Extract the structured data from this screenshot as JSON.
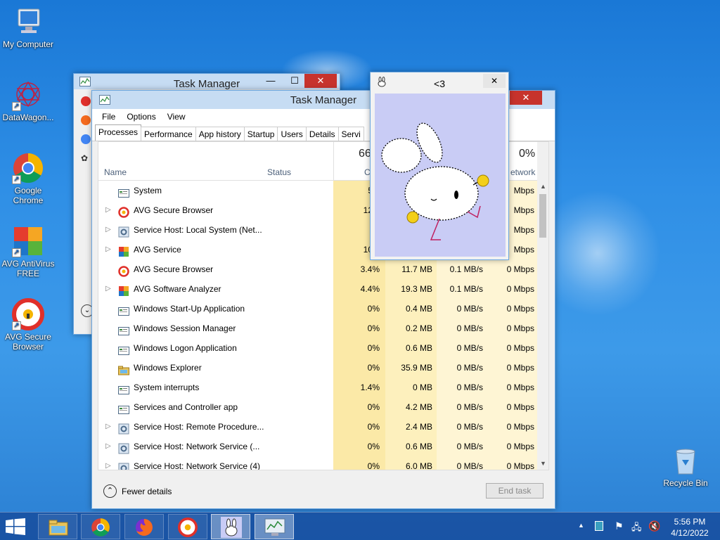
{
  "desktop_icons": [
    {
      "label": "My Computer",
      "icon": "computer-icon"
    },
    {
      "label": "DataWagon...",
      "icon": "datawagon-icon"
    },
    {
      "label": "Google Chrome",
      "icon": "chrome-icon"
    },
    {
      "label": "AVG AntiVirus FREE",
      "icon": "avg-antivirus-icon"
    },
    {
      "label": "AVG Secure Browser",
      "icon": "avg-secure-browser-icon"
    },
    {
      "label": "Recycle Bin",
      "icon": "recycle-bin-icon"
    }
  ],
  "back_window": {
    "title": "Task Manager"
  },
  "front_window": {
    "title": "Task Manager",
    "menu": [
      "File",
      "Options",
      "View"
    ],
    "tabs": [
      "Processes",
      "Performance",
      "App history",
      "Startup",
      "Users",
      "Details",
      "Servi"
    ],
    "headers": {
      "name": "Name",
      "status": "Status",
      "cpu_pct": "66",
      "cpu": "C",
      "net_pct": "0%",
      "net": "etwork"
    },
    "rows": [
      {
        "name": "System",
        "expand": "",
        "icon": "system-icon",
        "cpu": "5.9",
        "mem": "",
        "disk": "",
        "net": "Mbps"
      },
      {
        "name": "AVG Secure Browser",
        "expand": "▷",
        "icon": "avg-browser-icon",
        "cpu": "12.4",
        "mem": "",
        "disk": "",
        "net": "Mbps"
      },
      {
        "name": "Service Host: Local System (Net...",
        "expand": "▷",
        "icon": "gear-icon",
        "cpu": "0",
        "mem": "",
        "disk": "",
        "net": "Mbps"
      },
      {
        "name": "AVG Service",
        "expand": "▷",
        "icon": "avg-icon",
        "cpu": "10.9",
        "mem": "",
        "disk": "",
        "net": "Mbps"
      },
      {
        "name": "AVG Secure Browser",
        "expand": "",
        "icon": "avg-browser-icon",
        "cpu": "3.4%",
        "mem": "11.7 MB",
        "disk": "0.1 MB/s",
        "net": "0 Mbps"
      },
      {
        "name": "AVG Software Analyzer",
        "expand": "▷",
        "icon": "avg-icon",
        "cpu": "4.4%",
        "mem": "19.3 MB",
        "disk": "0.1 MB/s",
        "net": "0 Mbps"
      },
      {
        "name": "Windows Start-Up Application",
        "expand": "",
        "icon": "system-icon",
        "cpu": "0%",
        "mem": "0.4 MB",
        "disk": "0 MB/s",
        "net": "0 Mbps"
      },
      {
        "name": "Windows Session Manager",
        "expand": "",
        "icon": "system-icon",
        "cpu": "0%",
        "mem": "0.2 MB",
        "disk": "0 MB/s",
        "net": "0 Mbps"
      },
      {
        "name": "Windows Logon Application",
        "expand": "",
        "icon": "system-icon",
        "cpu": "0%",
        "mem": "0.6 MB",
        "disk": "0 MB/s",
        "net": "0 Mbps"
      },
      {
        "name": "Windows Explorer",
        "expand": "",
        "icon": "explorer-icon",
        "cpu": "0%",
        "mem": "35.9 MB",
        "disk": "0 MB/s",
        "net": "0 Mbps"
      },
      {
        "name": "System interrupts",
        "expand": "",
        "icon": "system-icon",
        "cpu": "1.4%",
        "mem": "0 MB",
        "disk": "0 MB/s",
        "net": "0 Mbps"
      },
      {
        "name": "Services and Controller app",
        "expand": "",
        "icon": "system-icon",
        "cpu": "0%",
        "mem": "4.2 MB",
        "disk": "0 MB/s",
        "net": "0 Mbps"
      },
      {
        "name": "Service Host: Remote Procedure...",
        "expand": "▷",
        "icon": "gear-icon",
        "cpu": "0%",
        "mem": "2.4 MB",
        "disk": "0 MB/s",
        "net": "0 Mbps"
      },
      {
        "name": "Service Host: Network Service (...",
        "expand": "▷",
        "icon": "gear-icon",
        "cpu": "0%",
        "mem": "0.6 MB",
        "disk": "0 MB/s",
        "net": "0 Mbps"
      },
      {
        "name": "Service Host: Network Service (4)",
        "expand": "▷",
        "icon": "gear-icon",
        "cpu": "0%",
        "mem": "6.0 MB",
        "disk": "0 MB/s",
        "net": "0 Mbps"
      }
    ],
    "fewer_details": "Fewer details",
    "end_task": "End task"
  },
  "bunny_window": {
    "title": "<3"
  },
  "taskbar": {
    "items": [
      "windows-start-icon",
      "file-explorer-icon",
      "chrome-icon",
      "firefox-icon",
      "avg-browser-icon",
      "bunny-app-icon",
      "task-manager-icon"
    ],
    "time": "5:56 PM",
    "date": "4/12/2022"
  },
  "colors": {
    "cpu_heat": "#fbe9a7",
    "cpu_heat_strong": "#f9de8a",
    "mem_heat": "#fdf2c4",
    "selection": "#c6dcf3",
    "close_red": "#c7332c"
  }
}
